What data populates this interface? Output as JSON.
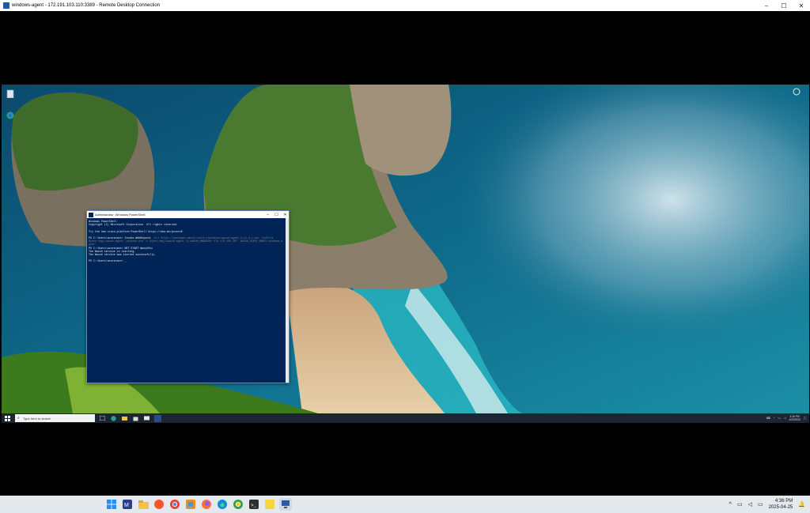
{
  "rdp_window": {
    "title": "windows-agent - 172.191.103.110:3389 - Remote Desktop Connection",
    "controls": {
      "minimize": "–",
      "maximize": "☐",
      "close": "✕"
    }
  },
  "powershell": {
    "title": "Administrator: Windows PowerShell",
    "lines": [
      {
        "text": "Windows PowerShell",
        "style": "normal"
      },
      {
        "text": "Copyright (C) Microsoft Corporation. All rights reserved.",
        "style": "normal"
      },
      {
        "text": "",
        "style": "normal"
      },
      {
        "text": "Try the new cross-platform PowerShell https://aka.ms/pscore6",
        "style": "normal"
      },
      {
        "text": "",
        "style": "normal"
      },
      {
        "text_prompt": "PS C:\\Users\\azureuser> ",
        "text_cmd": "Invoke-WebRequest",
        "text_rest": " -Uri https://packages.wazuh.com/4.x/windows/wazuh-agent-4.11.2-1.msi -OutFile",
        "style": "cmd"
      },
      {
        "text": "${env:tmp}\\wazuh-agent; msiexec.exe /i ${env:tmp}\\wazuh-agent /q WAZUH_MANAGER='172.173.106.207' WAZUH_AGENT_NAME='windows-a",
        "style": "param"
      },
      {
        "text": "gent'",
        "style": "param"
      },
      {
        "text": "PS C:\\Users\\azureuser> NET START WazuhSvc",
        "style": "normal"
      },
      {
        "text": "The Wazuh service is starting.",
        "style": "normal"
      },
      {
        "text": "The Wazuh service was started successfully.",
        "style": "normal"
      },
      {
        "text": "",
        "style": "normal"
      },
      {
        "text": "PS C:\\Users\\azureuser> _",
        "style": "normal"
      }
    ]
  },
  "remote_taskbar": {
    "search_placeholder": "Type here to search",
    "clock_time": "4:36 PM",
    "clock_date": "4/25/2025",
    "icons": [
      "task-view-icon",
      "edge-icon",
      "file-explorer-icon",
      "store-icon",
      "mail-icon",
      "powershell-icon"
    ]
  },
  "host_taskbar": {
    "clock_time": "4:36 PM",
    "clock_date": "2025-04-25",
    "apps": [
      "windows-start-icon",
      "terminal-app-icon",
      "file-explorer-icon",
      "brave-icon",
      "chrome-icon",
      "capture-icon",
      "firefox-icon",
      "edge-icon",
      "chrome-dev-icon",
      "terminal-icon",
      "sticky-notes-icon",
      "remote-desktop-icon"
    ]
  }
}
